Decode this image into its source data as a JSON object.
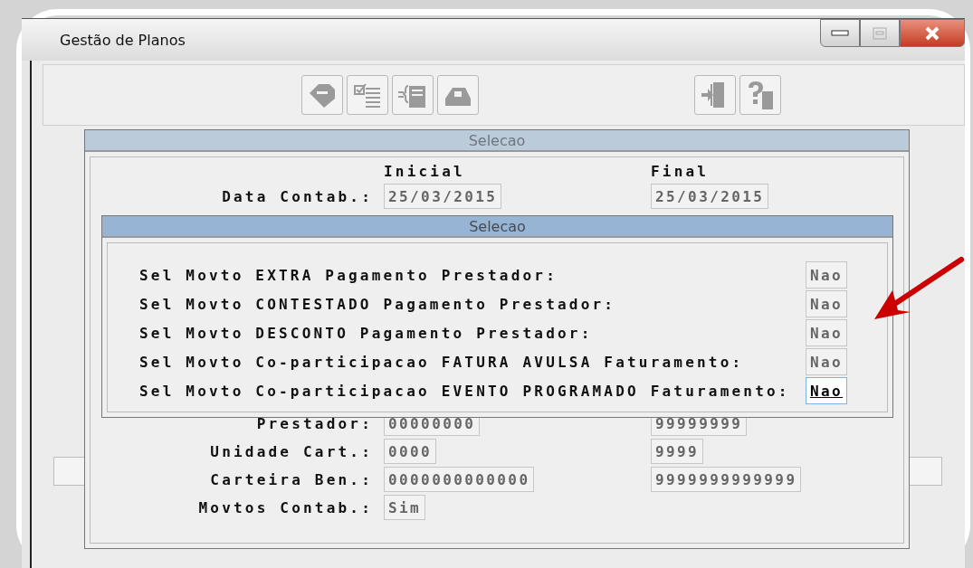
{
  "window": {
    "title": "Gestão de Planos"
  },
  "outer_dialog": {
    "title": "Selecao",
    "column_headers": [
      "Inicial",
      "Final"
    ],
    "rows": [
      {
        "label": "Data Contab.:",
        "initial": "25/03/2015",
        "final": "25/03/2015"
      },
      {
        "label": "Prestador:",
        "initial": "00000000",
        "final": "99999999"
      },
      {
        "label": "Unidade Cart.:",
        "initial": "0000",
        "final": "9999"
      },
      {
        "label": "Carteira Ben.:",
        "initial": "0000000000000",
        "final": "9999999999999"
      },
      {
        "label": "Movtos Contab.:",
        "initial": "Sim"
      }
    ]
  },
  "inner_dialog": {
    "title": "Selecao",
    "rows": [
      {
        "label": "Sel Movto EXTRA Pagamento Prestador:",
        "value": "Nao",
        "focused": false
      },
      {
        "label": "Sel Movto CONTESTADO Pagamento Prestador:",
        "value": "Nao",
        "focused": false
      },
      {
        "label": "Sel Movto DESCONTO Pagamento Prestador:",
        "value": "Nao",
        "focused": false
      },
      {
        "label": "Sel Movto Co-participacao FATURA AVULSA Faturamento:",
        "value": "Nao",
        "focused": false
      },
      {
        "label": "Sel Movto Co-participacao EVENTO PROGRAMADO Faturamento:",
        "value": "Nao",
        "focused": true
      }
    ]
  }
}
